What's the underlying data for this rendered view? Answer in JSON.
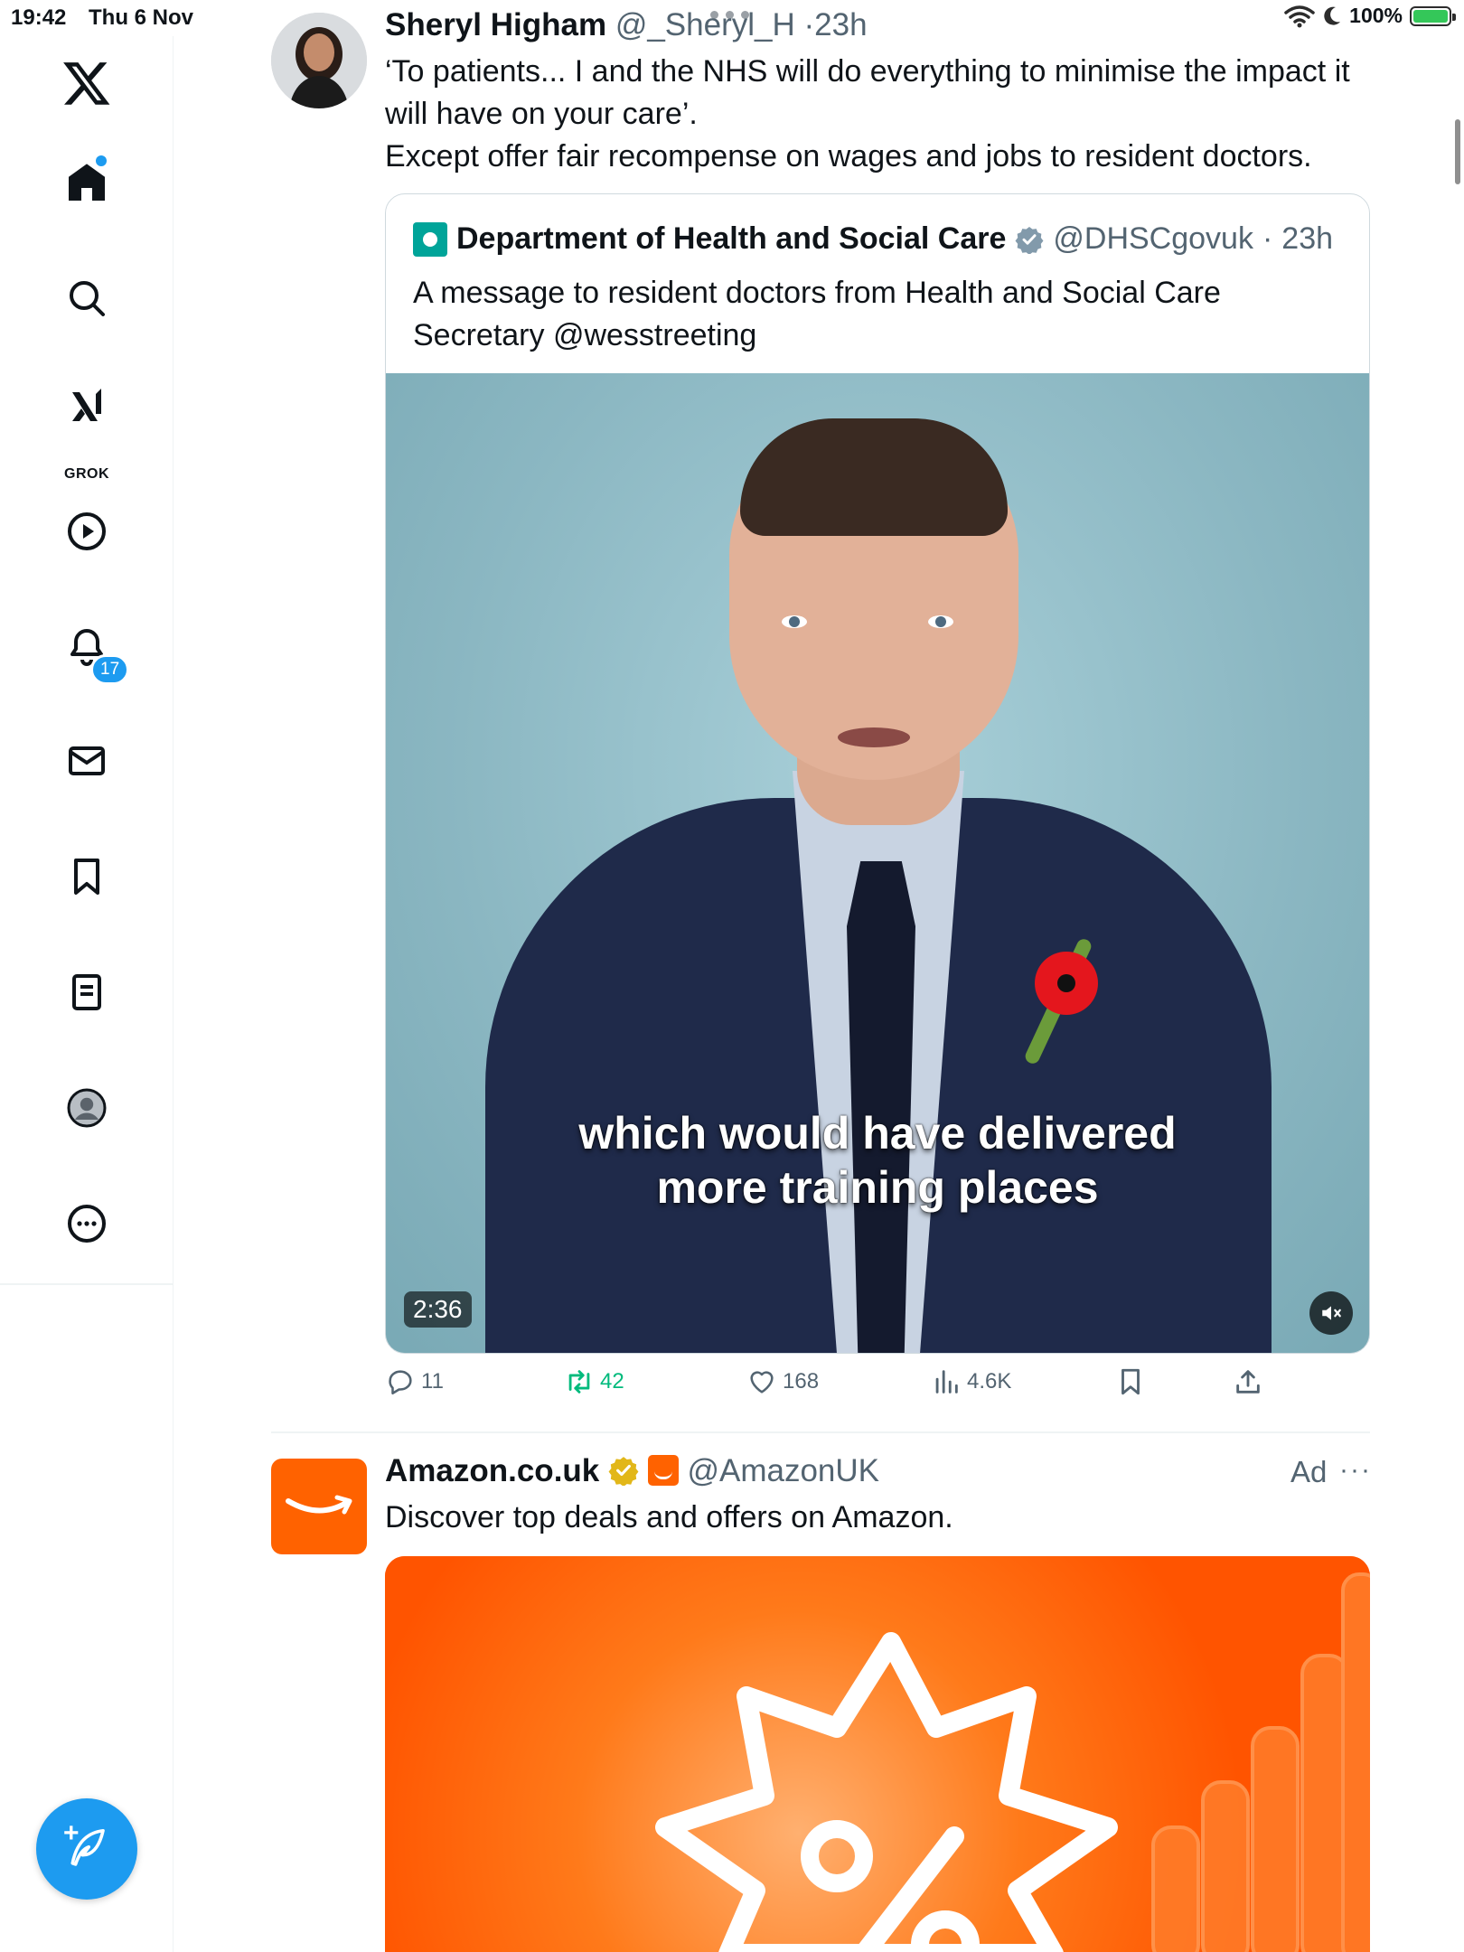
{
  "status_bar": {
    "time": "19:42",
    "date": "Thu 6 Nov",
    "battery": "100%"
  },
  "sidebar": {
    "logo": "x-logo-icon",
    "items": [
      {
        "name": "home",
        "icon": "home-icon"
      },
      {
        "name": "explore",
        "icon": "search-icon"
      },
      {
        "name": "grok",
        "icon": "grok-icon",
        "label": "GROK"
      },
      {
        "name": "video",
        "icon": "play-icon"
      },
      {
        "name": "notifications",
        "icon": "bell-icon",
        "badge": "17"
      },
      {
        "name": "messages",
        "icon": "mail-icon"
      },
      {
        "name": "bookmarks",
        "icon": "bookmark-icon"
      },
      {
        "name": "lists",
        "icon": "list-icon"
      },
      {
        "name": "profile",
        "icon": "profile-icon"
      },
      {
        "name": "more",
        "icon": "more-icon"
      }
    ],
    "compose": "compose-icon"
  },
  "tweet": {
    "author_name": "Sheryl Higham",
    "author_handle": "@_Sheryl_H",
    "separator": "·",
    "time": "23h",
    "text_lines": [
      "‘To patients... I and the NHS will do everything to minimise the impact it",
      "will have on your care’.",
      "Except offer fair recompense on wages and jobs to resident doctors."
    ],
    "quote": {
      "author_name": "Department of Health and Social Care",
      "author_handle": "@DHSCgovuk",
      "separator": "·",
      "time": "23h",
      "text_lines": [
        "A message to resident doctors from Health and Social Care",
        "Secretary @wesstreeting"
      ],
      "video": {
        "caption_line1": "which would have delivered",
        "caption_line2": "more training places",
        "duration": "2:36"
      }
    },
    "actions": {
      "replies": "11",
      "retweets": "42",
      "likes": "168",
      "views": "4.6K"
    }
  },
  "ad": {
    "author_name": "Amazon.co.uk",
    "author_handle": "@AmazonUK",
    "ad_label": "Ad",
    "more": "···",
    "text": "Discover top deals and offers on Amazon."
  },
  "colors": {
    "accent": "#1d9bf0",
    "retweet": "#00ba7c",
    "secondary_text": "#536471",
    "amazon_orange": "#ff6200",
    "dhsc_teal": "#00a499"
  }
}
